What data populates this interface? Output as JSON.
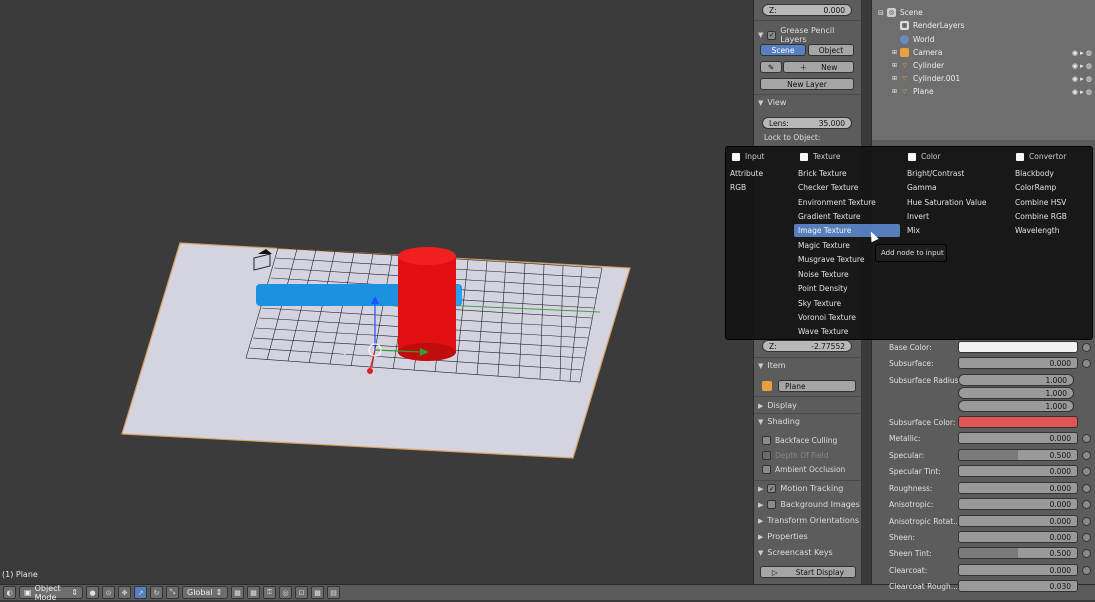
{
  "viewport": {
    "object_label": "(1) Plane"
  },
  "bottom_bar": {
    "mode": "Object Mode",
    "orientation": "Global"
  },
  "npanel": {
    "z_top": {
      "label": "Z:",
      "value": "0.000"
    },
    "grease_pencil": {
      "title": "Grease Pencil Layers",
      "scene_tab": "Scene",
      "object_tab": "Object",
      "new_label": "New",
      "new_layer_label": "New Layer"
    },
    "view": {
      "title": "View",
      "lens_label": "Lens:",
      "lens_value": "35.000",
      "lock_label": "Lock to Object:"
    },
    "z_bottom": {
      "label": "Z:",
      "value": "-2.77552"
    },
    "item": {
      "title": "Item",
      "name": "Plane"
    },
    "display_title": "Display",
    "shading": {
      "title": "Shading",
      "backface": "Backface Culling",
      "dof": "Depth Of Field",
      "ao": "Ambient Occlusion"
    },
    "motion_tracking": "Motion Tracking",
    "background_images": "Background Images",
    "transform_orientations": "Transform Orientations",
    "properties_title": "Properties",
    "screencast": {
      "title": "Screencast Keys",
      "start": "Start Display"
    }
  },
  "outliner": {
    "rows": [
      {
        "label": "Scene"
      },
      {
        "label": "RenderLayers"
      },
      {
        "label": "World"
      },
      {
        "label": "Camera"
      },
      {
        "label": "Cylinder"
      },
      {
        "label": "Cylinder.001"
      },
      {
        "label": "Plane"
      }
    ]
  },
  "properties": {
    "base_color_label": "Base Color:",
    "subsurface_label": "Subsurface:",
    "subsurface_value": "0.000",
    "subsurface_radius_label": "Subsurface Radius:",
    "radius_values": [
      "1.000",
      "1.000",
      "1.000"
    ],
    "subsurface_color_label": "Subsurface Color:",
    "base_color": "#f2f2f2",
    "subsurface_color": "#e05555",
    "rows": [
      {
        "label": "Metallic:",
        "value": "0.000"
      },
      {
        "label": "Specular:",
        "value": "0.500"
      },
      {
        "label": "Specular Tint:",
        "value": "0.000"
      },
      {
        "label": "Roughness:",
        "value": "0.000"
      },
      {
        "label": "Anisotropic:",
        "value": "0.000"
      },
      {
        "label": "Anisotropic Rotat...",
        "value": "0.000"
      },
      {
        "label": "Sheen:",
        "value": "0.000"
      },
      {
        "label": "Sheen Tint:",
        "value": "0.500"
      },
      {
        "label": "Clearcoat:",
        "value": "0.000"
      },
      {
        "label": "Clearcoat Rough...",
        "value": "0.030"
      }
    ]
  },
  "menu": {
    "headers": [
      "Input",
      "Texture",
      "Color",
      "Convertor"
    ],
    "input": [
      "Attribute",
      "RGB"
    ],
    "texture": [
      "Brick Texture",
      "Checker Texture",
      "Environment Texture",
      "Gradient Texture",
      "Image Texture",
      "Magic Texture",
      "Musgrave Texture",
      "Noise Texture",
      "Point Density",
      "Sky Texture",
      "Voronoi Texture",
      "Wave Texture"
    ],
    "color": [
      "Bright/Contrast",
      "Gamma",
      "Hue Saturation Value",
      "Invert",
      "Mix"
    ],
    "convertor": [
      "Blackbody",
      "ColorRamp",
      "Combine HSV",
      "Combine RGB",
      "Wavelength"
    ],
    "selected": "Image Texture",
    "tooltip": "Add node to input"
  }
}
